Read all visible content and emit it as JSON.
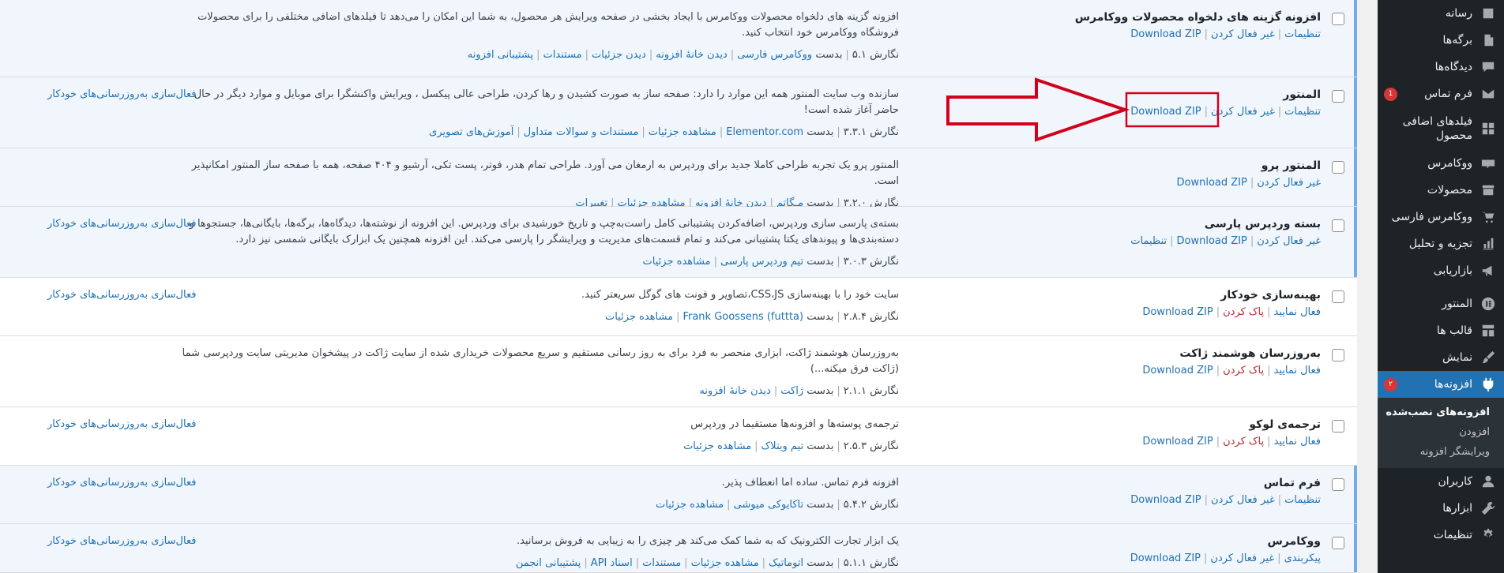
{
  "sidebar": {
    "items": [
      {
        "label": "رسانه",
        "icon": "media-icon"
      },
      {
        "label": "برگه‌ها",
        "icon": "pages-icon"
      },
      {
        "label": "دیدگاه‌ها",
        "icon": "comments-icon"
      },
      {
        "label": "فرم تماس",
        "icon": "mail-icon",
        "badge": "1"
      },
      {
        "label": "فیلدهای اضافی محصول",
        "icon": "grid-icon"
      },
      {
        "label": "ووکامرس",
        "icon": "woo-icon"
      },
      {
        "label": "محصولات",
        "icon": "archive-icon"
      },
      {
        "label": "ووکامرس فارسی",
        "icon": "cart-icon"
      },
      {
        "label": "تجزیه و تحلیل",
        "icon": "chart-bar-icon"
      },
      {
        "label": "بازاریابی",
        "icon": "megaphone-icon"
      },
      {
        "label": "المنتور",
        "icon": "elementor-icon"
      },
      {
        "label": "قالب ها",
        "icon": "template-icon"
      },
      {
        "label": "نمایش",
        "icon": "paintbrush-icon"
      },
      {
        "label": "افزونه‌ها",
        "icon": "plugin-icon",
        "badge": "۲"
      },
      {
        "label": "کاربران",
        "icon": "users-icon"
      },
      {
        "label": "ابزارها",
        "icon": "tools-icon"
      },
      {
        "label": "تنظیمات",
        "icon": "settings-icon"
      }
    ],
    "submenu": [
      "افزونه‌های نصب‌شده",
      "افزودن",
      "ویرایشگر افزونه"
    ]
  },
  "plugins": [
    {
      "name": "افزونه گزینه های دلخواه محصولات ووکامرس",
      "actions": [
        "تنظیمات",
        "غیر فعال کردن",
        "Download ZIP"
      ],
      "desc": "افزونه گزینه های دلخواه محصولات ووکامرس با ایجاد بخشی در صفحه ویرایش هر محصول، به شما این امکان را می‌دهد تا فیلدهای اضافی مختلفی را برای محصولات فروشگاه ووکامرس خود انتخاب کنید.",
      "version": "نگارش ۵.۱",
      "by": "بدست",
      "author": "ووکامرس فارسی",
      "links": [
        "دیدن خانهٔ افزونه",
        "دیدن جزئیات",
        "مستندات",
        "پشتیبانی افزونه"
      ],
      "auto": ""
    },
    {
      "name": "المنتور",
      "actions": [
        "تنظیمات",
        "غیر فعال کردن",
        "Download ZIP"
      ],
      "desc": "سازنده وب سایت المنتور همه این موارد را دارد: صفحه ساز به صورت کشیدن و رها کردن، طراحی عالی پیکسل ، ویرایش واکنشگرا برای موبایل و موارد دیگر در حال حاضر آغاز شده است!",
      "version": "نگارش ۳.۳.۱",
      "by": "بدست",
      "author": "Elementor.com",
      "links": [
        "مشاهده جزئیات",
        "مستندات و سوالات متداول",
        "آموزش‌های تصویری"
      ],
      "auto": "فعال‌سازی به‌روزرسانی‌های خودکار"
    },
    {
      "name": "المنتور پرو",
      "actions": [
        "غیر فعال کردن",
        "Download ZIP"
      ],
      "desc": "المنتور پرو یک تجربه طراحی کاملا جدید برای وردپرس به ارمغان می آورد. طراحی تمام هدر، فوتر، پست تکی، آرشیو و ۴۰۴ صفحه، همه با صفحه ساز المنتور امکانپذیر است.",
      "version": "نگارش ۳.۲.۰",
      "by": "بدست",
      "author": "مـگاتم",
      "links": [
        "دیدن خانهٔ افزونه",
        "مشاهده جزئیات",
        "تغییرات"
      ],
      "auto": ""
    },
    {
      "name": "بسته وردپرس پارسی",
      "actions": [
        "غیر فعال کردن",
        "Download ZIP",
        "تنظیمات"
      ],
      "desc": "بسته‌ی پارسی سازی وردپرس، اضافه‌کردن پشتیبانی کامل راست‌به‌چپ و تاریخ خورشیدی برای وردپرس. این افزونه از نوشته‌ها، دیدگاه‌ها، برگه‌ها، بایگانی‌ها، جستجوها و دسته‌بندی‌ها و پیوندهای یکتا پشتیبانی می‌کند و تمام قسمت‌های مدیریت و ویرایشگر را پارسی می‌کند. این افزونه همچنین یک ابزارک بایگانی شمسی نیز دارد.",
      "version": "نگارش ۳.۰.۳",
      "by": "بدست",
      "author": "تیم وردپرس پارسی",
      "links": [
        "مشاهده جزئیات"
      ],
      "auto": "فعال‌سازی به‌روزرسانی‌های خودکار"
    },
    {
      "name": "بهینه‌سازی خودکار",
      "actions": [
        "فعال نمایید",
        "پاک کردن",
        "Download ZIP"
      ],
      "desc": "سایت خود را با بهینه‌سازی CSS،JS،تصاویر و فونت های گوگل سریعتر کنید.",
      "version": "نگارش ۲.۸.۴",
      "by": "بدست",
      "author": "Frank Goossens (futtta)",
      "links": [
        "مشاهده جزئیات"
      ],
      "auto": "فعال‌سازی به‌روزرسانی‌های خودکار"
    },
    {
      "name": "به‌روزرسان هوشمند ژاکت",
      "actions": [
        "فعال نمایید",
        "پاک کردن",
        "Download ZIP"
      ],
      "desc": "به‌روزرسان هوشمند ژاکت، ابزاری منحصر به فرد برای به روز رسانی مستقیم و سریع محصولات خریداری شده از سایت ژاکت در پیشخوان مدیریتی سایت وردپرسی شما (ژاکت فرق میکنه...)",
      "version": "نگارش ۲.۱.۱",
      "by": "بدست",
      "author": "ژاکت",
      "links": [
        "دیدن خانهٔ افزونه"
      ],
      "auto": ""
    },
    {
      "name": "ترجمه‌ی لوکو",
      "actions": [
        "فعال نمایید",
        "پاک کردن",
        "Download ZIP"
      ],
      "desc": "ترجمه‌ی پوسته‌ها و افزونه‌ها مستقیما در وردپرس",
      "version": "نگارش ۲.۵.۳",
      "by": "بدست",
      "author": "تیم ویتلاک",
      "links": [
        "مشاهده جزئیات"
      ],
      "auto": "فعال‌سازی به‌روزرسانی‌های خودکار"
    },
    {
      "name": "فرم تماس",
      "actions": [
        "تنظیمات",
        "غیر فعال کردن",
        "Download ZIP"
      ],
      "desc": "افزونه فرم تماس. ساده اما انعطاف پذیر.",
      "version": "نگارش ۵.۴.۲",
      "by": "بدست",
      "author": "تاکایوکی میوشی",
      "links": [
        "مشاهده جزئیات"
      ],
      "auto": "فعال‌سازی به‌روزرسانی‌های خودکار"
    },
    {
      "name": "ووکامرس",
      "actions": [
        "پیکربندی",
        "غیر فعال کردن",
        "Download ZIP"
      ],
      "desc": "یک ابزار تجارت الکترونیک که به شما کمک می‌کند هر چیزی را به زیبایی به فروش برسانید.",
      "version": "نگارش ۵.۱.۱",
      "by": "بدست",
      "author": "اتوماتیک",
      "links": [
        "مشاهده جزئیات",
        "مستندات",
        "اسناد API",
        "پشتیبانی انجمن"
      ],
      "auto": "فعال‌سازی به‌روزرسانی‌های خودکار"
    }
  ],
  "colors": {
    "accent": "#2271b1",
    "sidebar_bg": "#1d2327",
    "active_row": "#f0f6fc",
    "annotation": "#d0021b"
  }
}
